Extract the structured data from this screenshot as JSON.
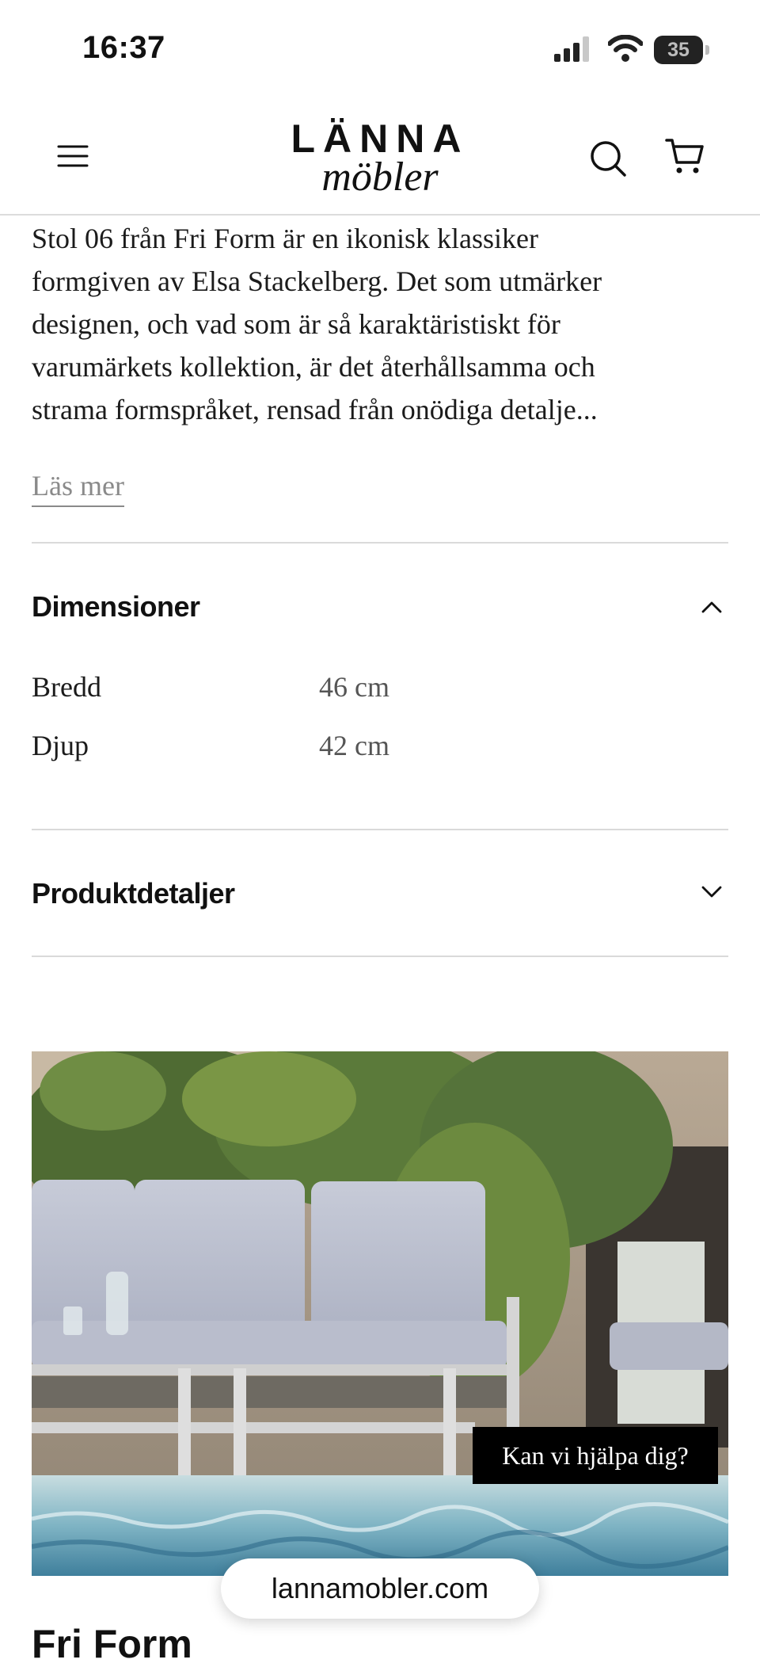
{
  "status_bar": {
    "time": "16:37",
    "battery": "35"
  },
  "header": {
    "logo_top": "LÄNNA",
    "logo_bottom": "möbler"
  },
  "description": {
    "lines": [
      "Stol 06 från Fri Form är en ikonisk klassiker",
      "formgiven av Elsa Stackelberg. Det som utmärker",
      "designen, och vad som är så karaktäristiskt för",
      "varumärkets kollektion, är det återhållsamma och",
      "strama formspråket, rensad från onödiga detalje..."
    ],
    "read_more": "Läs mer"
  },
  "dimensions": {
    "title": "Dimensioner",
    "rows": [
      {
        "label": "Bredd",
        "value": "46 cm"
      },
      {
        "label": "Djup",
        "value": "42 cm"
      }
    ]
  },
  "product_details": {
    "title": "Produktdetaljer"
  },
  "chat": {
    "label": "Kan vi hjälpa dig?"
  },
  "browser": {
    "url": "lannamobler.com"
  },
  "next_section": {
    "title": "Fri Form"
  }
}
